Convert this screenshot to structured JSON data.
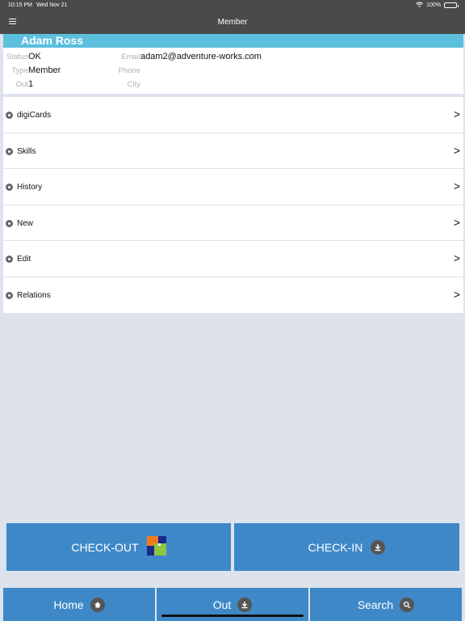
{
  "status_bar": {
    "time": "10:15 PM",
    "date": "Wed Nov 21",
    "battery": "100%"
  },
  "nav": {
    "title": "Member"
  },
  "member": {
    "name": "Adam Ross",
    "status_label": "Status",
    "status": "OK",
    "type_label": "Type",
    "type": "Member",
    "out_label": "Out",
    "out": "1",
    "email_label": "Email",
    "email": "adam2@adventure-works.com",
    "phone_label": "Phone",
    "phone": "",
    "city_label": "City",
    "city": ""
  },
  "menu": [
    {
      "label": "digiCards",
      "icon": "check-circle-icon"
    },
    {
      "label": "Skills",
      "icon": "star-circle-icon"
    },
    {
      "label": "History",
      "icon": "clock-circle-icon"
    },
    {
      "label": "New",
      "icon": "radio-circle-icon"
    },
    {
      "label": "Edit",
      "icon": "radio-circle-icon"
    },
    {
      "label": "Relations",
      "icon": "radio-circle-icon"
    }
  ],
  "chevron": ">",
  "actions": {
    "checkout": "CHECK-OUT",
    "checkin": "CHECK-IN"
  },
  "tabs": {
    "home": "Home",
    "out": "Out",
    "search": "Search"
  },
  "colors": {
    "header": "#4a4a4a",
    "name_bar": "#5bbfdd",
    "button": "#3f88c8",
    "background": "#dde2ec"
  }
}
